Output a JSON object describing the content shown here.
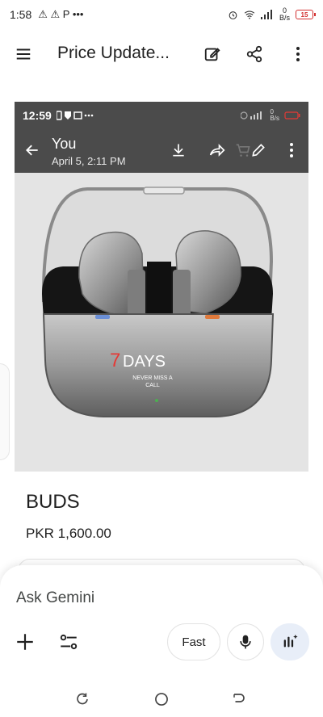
{
  "status_bar": {
    "time": "1:58",
    "left_icons": "⚠ ⚠ P •••",
    "speed_value": "0",
    "speed_unit": "B/s",
    "battery": "15"
  },
  "app_bar": {
    "title": "Price Update..."
  },
  "shared_image": {
    "status_time": "12:59",
    "status_speed": "0",
    "status_speed_unit": "B/s",
    "sender": "You",
    "timestamp": "April 5, 2:11 PM",
    "overlay_days_number": "7",
    "overlay_days_word": "DAYS",
    "overlay_line1": "NEVER MISS A",
    "overlay_line2": "CALL"
  },
  "product": {
    "name": "BUDS",
    "price": "PKR 1,600.00"
  },
  "gemini": {
    "placeholder": "Ask Gemini",
    "mode_label": "Fast"
  },
  "colors": {
    "inner_bar": "#4b4b4b",
    "accent_red": "#e53935",
    "live_button_bg": "#e8eef8"
  }
}
